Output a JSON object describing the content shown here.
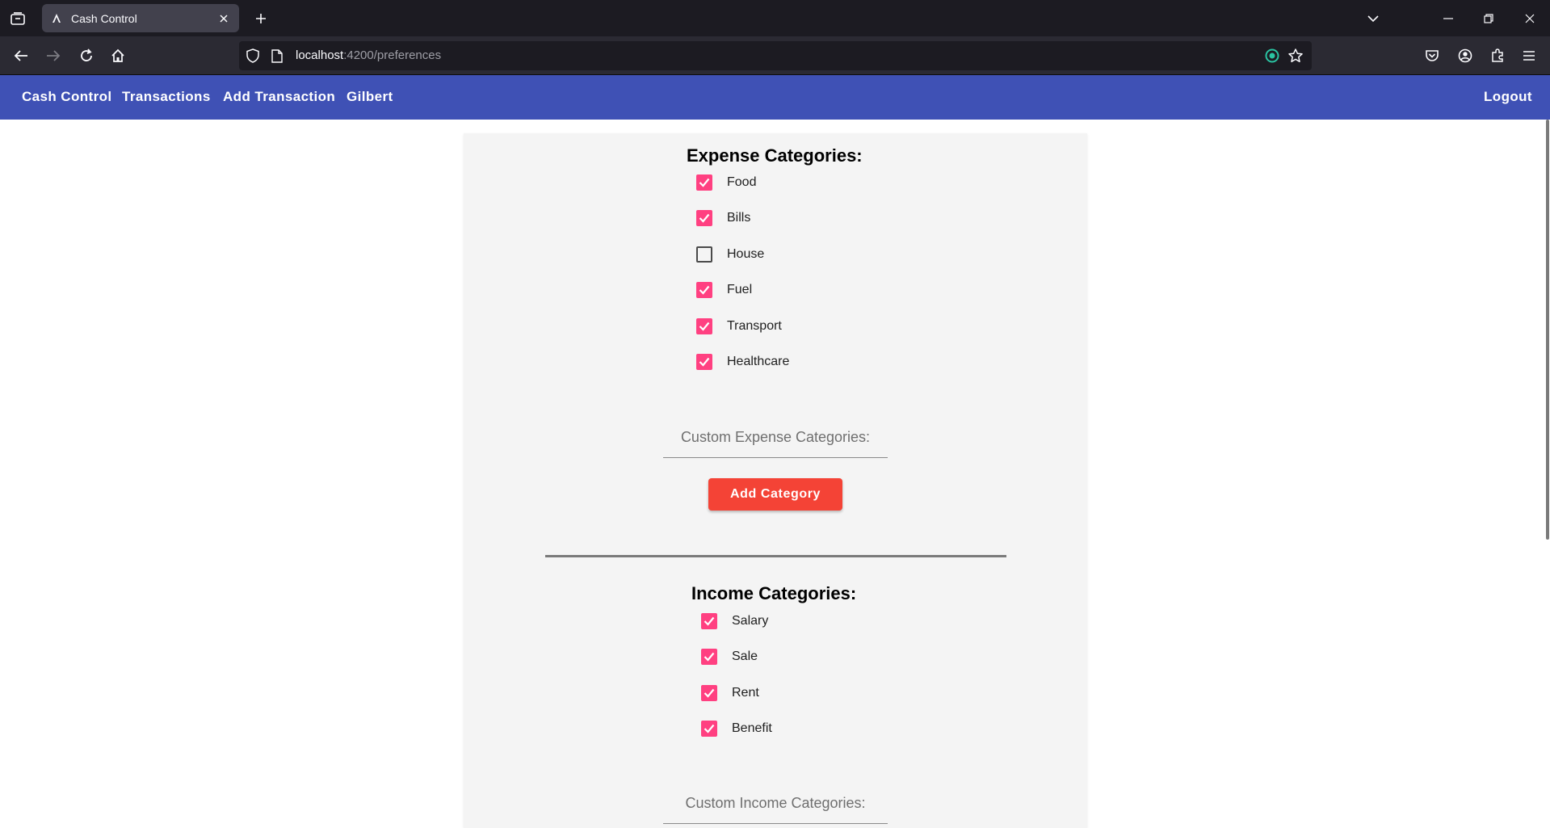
{
  "browser": {
    "tab_title": "Cash Control",
    "url_host": "localhost",
    "url_path": ":4200/preferences"
  },
  "app": {
    "brand": "Cash Control",
    "nav": {
      "transactions": "Transactions",
      "add_transaction": "Add Transaction",
      "user": "Gilbert",
      "logout": "Logout"
    },
    "colors": {
      "toolbar": "#3f51b5",
      "checkbox_accent": "#ff4081",
      "button_warn": "#f44336"
    }
  },
  "expense": {
    "title": "Expense Categories:",
    "items": [
      {
        "label": "Food",
        "checked": true
      },
      {
        "label": "Bills",
        "checked": true
      },
      {
        "label": "House",
        "checked": false
      },
      {
        "label": "Fuel",
        "checked": true
      },
      {
        "label": "Transport",
        "checked": true
      },
      {
        "label": "Healthcare",
        "checked": true
      }
    ],
    "custom_placeholder": "Custom Expense Categories:",
    "add_button": "Add Category"
  },
  "income": {
    "title": "Income Categories:",
    "items": [
      {
        "label": "Salary",
        "checked": true
      },
      {
        "label": "Sale",
        "checked": true
      },
      {
        "label": "Rent",
        "checked": true
      },
      {
        "label": "Benefit",
        "checked": true
      }
    ],
    "custom_placeholder": "Custom Income Categories:"
  }
}
